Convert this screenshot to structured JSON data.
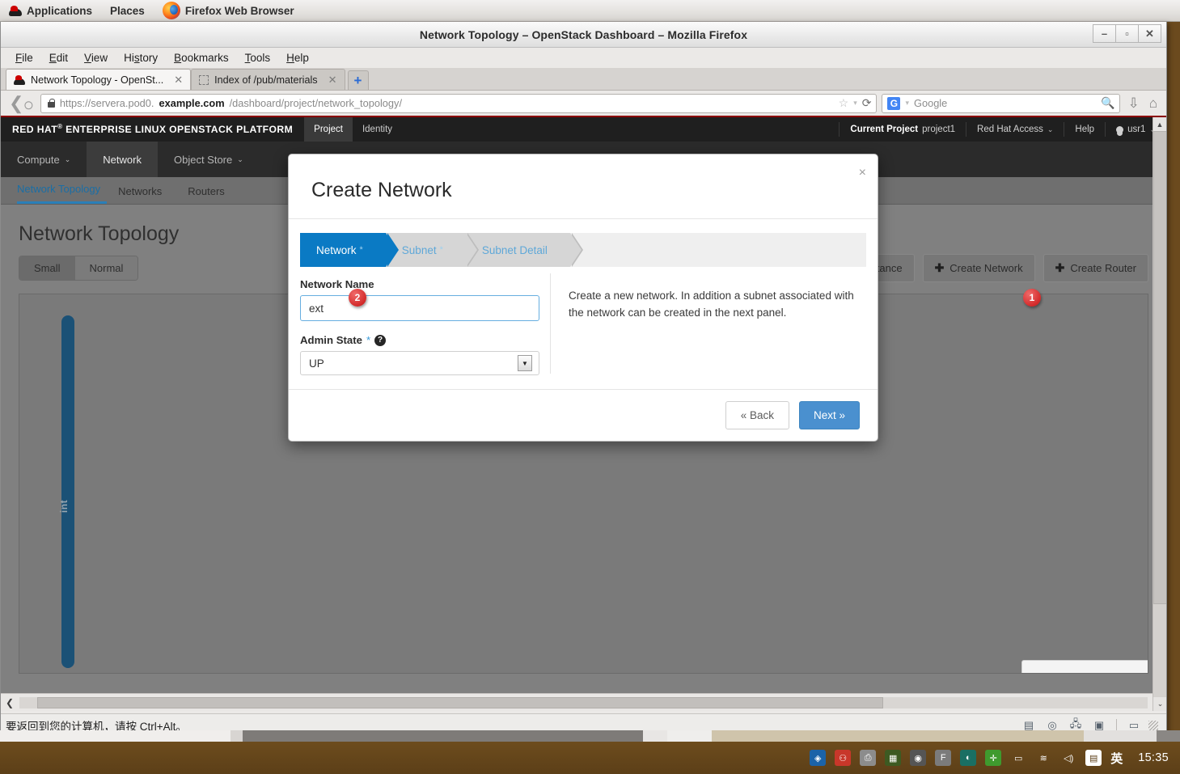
{
  "desktop": {
    "panel": {
      "applications": "Applications",
      "places": "Places",
      "active_window": "Firefox Web Browser"
    },
    "taskbar": {
      "clock": "15:35",
      "ime_label": "英",
      "tray_icons": [
        "archive-manager-icon",
        "penguin-user-icon",
        "printer-icon",
        "nvidia-settings-icon",
        "shell-icon",
        "font-icon",
        "chrome-like-icon",
        "add-plugin-icon",
        "battery-icon",
        "wifi-icon",
        "volume-icon",
        "notes-icon"
      ]
    }
  },
  "browser": {
    "window_title": "Network Topology – OpenStack Dashboard – Mozilla Firefox",
    "window_buttons": {
      "minimize": "–",
      "maximize": "▫",
      "close": "✕"
    },
    "menu": [
      {
        "pre": "",
        "accel": "F",
        "post": "ile"
      },
      {
        "pre": "",
        "accel": "E",
        "post": "dit"
      },
      {
        "pre": "",
        "accel": "V",
        "post": "iew"
      },
      {
        "pre": "Hi",
        "accel": "s",
        "post": "tory"
      },
      {
        "pre": "",
        "accel": "B",
        "post": "ookmarks"
      },
      {
        "pre": "",
        "accel": "T",
        "post": "ools"
      },
      {
        "pre": "",
        "accel": "H",
        "post": "elp"
      }
    ],
    "tabs": [
      {
        "title": "Network Topology - OpenSt...",
        "active": true
      },
      {
        "title": "Index of /pub/materials",
        "active": false
      }
    ],
    "new_tab_label": "+",
    "url": {
      "prefix": "https://servera.pod0.",
      "domain": "example.com",
      "path": "/dashboard/project/network_topology/"
    },
    "search": {
      "engine": "G",
      "placeholder": "Google"
    },
    "status_message": "要返回到您的计算机，请按 Ctrl+Alt。"
  },
  "openstack": {
    "brand": "RED HAT",
    "brand_sup": "®",
    "brand_rest": "ENTERPRISE LINUX OPENSTACK PLATFORM",
    "top_nav": [
      {
        "label": "Project",
        "active": true
      },
      {
        "label": "Identity",
        "active": false
      }
    ],
    "right_nav": {
      "current_project_label": "Current Project",
      "current_project_value": "project1",
      "red_hat_access": "Red Hat Access",
      "help": "Help",
      "user": "usr1"
    },
    "sub_nav": [
      {
        "label": "Compute",
        "caret": true,
        "active": false
      },
      {
        "label": "Network",
        "caret": false,
        "active": true
      },
      {
        "label": "Object Store",
        "caret": true,
        "active": false
      }
    ],
    "panel_tabs": [
      {
        "label": "Network Topology",
        "active": true
      },
      {
        "label": "Networks",
        "active": false
      },
      {
        "label": "Routers",
        "active": false
      }
    ],
    "page_title": "Network Topology",
    "size_toggle": [
      {
        "label": "Small",
        "active": false
      },
      {
        "label": "Normal",
        "active": true
      }
    ],
    "action_buttons": [
      {
        "label": "Instance",
        "icon": "plus-icon"
      },
      {
        "label": "Create Network",
        "icon": "plus-icon"
      },
      {
        "label": "Create Router",
        "icon": "plus-icon"
      }
    ],
    "topology": {
      "network_label": "int",
      "network_color": "#1b5176"
    }
  },
  "modal": {
    "title": "Create Network",
    "close_label": "×",
    "steps": [
      {
        "label": "Network",
        "required_mark": "*",
        "active": true
      },
      {
        "label": "Subnet",
        "required_mark": "*",
        "active": false
      },
      {
        "label": "Subnet Detail",
        "required_mark": "",
        "active": false
      }
    ],
    "network_name": {
      "label": "Network Name",
      "value": "ext"
    },
    "admin_state": {
      "label": "Admin State",
      "required_mark": "*",
      "help_icon": "question-icon",
      "value": "UP"
    },
    "help_text": "Create a new network. In addition a subnet associated with the network can be created in the next panel.",
    "buttons": {
      "back": "« Back",
      "next": "Next »"
    }
  },
  "callouts": [
    {
      "number": "1",
      "target": "create-network-button"
    },
    {
      "number": "2",
      "target": "network-name-input"
    }
  ],
  "colors": {
    "accent_blue": "#0a7ac4",
    "button_blue": "#4a90cf",
    "brand_red": "#cc0000",
    "badge_red": "#d32b2b",
    "network_blue": "#1b5176"
  }
}
